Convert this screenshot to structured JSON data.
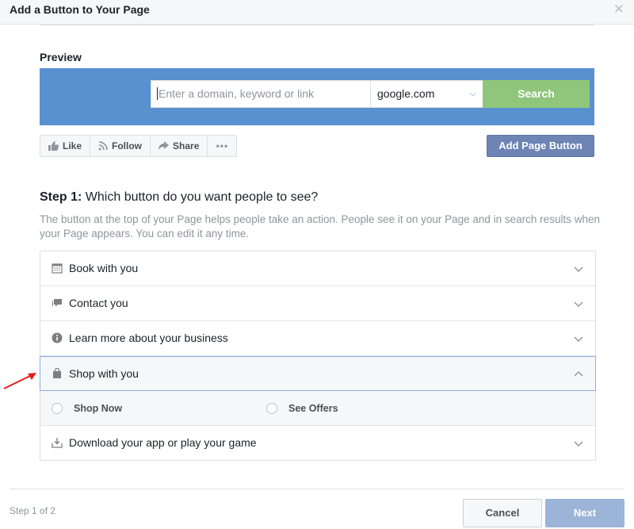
{
  "dialog": {
    "title": "Add a Button to Your Page",
    "close_icon": "close-icon"
  },
  "preview": {
    "title": "Preview",
    "search": {
      "placeholder": "Enter a domain, keyword or link",
      "value": "",
      "domain_value": "google.com",
      "button_label": "Search"
    },
    "actions": [
      {
        "label": "Like",
        "icon": "thumbs-up-icon"
      },
      {
        "label": "Follow",
        "icon": "rss-icon"
      },
      {
        "label": "Share",
        "icon": "share-arrow-icon"
      },
      {
        "label": "",
        "icon": "more-icon"
      }
    ],
    "add_button_label": "Add Page Button"
  },
  "step": {
    "heading_bold": "Step 1:",
    "heading_text": " Which button do you want people to see?",
    "description": "The button at the top of your Page helps people take an action. People see it on your Page and in search results when your Page appears. You can edit it any time.",
    "options": [
      {
        "label": "Book with you",
        "icon": "calendar-icon",
        "expanded": false
      },
      {
        "label": "Contact you",
        "icon": "chat-icon",
        "expanded": false
      },
      {
        "label": "Learn more about your business",
        "icon": "info-icon",
        "expanded": false
      },
      {
        "label": "Shop with you",
        "icon": "shopping-bag-icon",
        "expanded": true
      },
      {
        "label": "Download your app or play your game",
        "icon": "download-icon",
        "expanded": false
      }
    ],
    "sub_options": [
      {
        "label": "Shop Now",
        "checked": false
      },
      {
        "label": "See Offers",
        "checked": false
      }
    ]
  },
  "footer": {
    "step_counter": "Step 1 of 2",
    "cancel_label": "Cancel",
    "next_label": "Next"
  },
  "colors": {
    "cover": "#5890d0",
    "search_button": "#8fc67c",
    "add_page_button": "#6d84b4",
    "next_button_disabled": "#9cb4d8",
    "annotation_arrow": "#e0201c"
  }
}
